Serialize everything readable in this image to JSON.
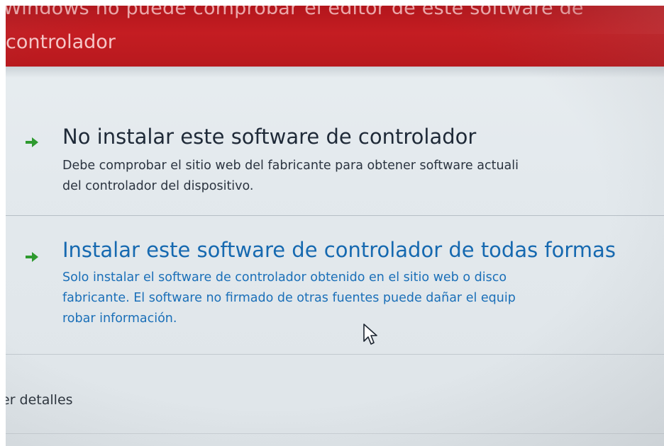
{
  "dialog": {
    "header_line1": "Windows no puede comprobar el editor de este software de",
    "header_line2": "controlador",
    "options": [
      {
        "title": "No instalar este software de controlador",
        "description_lines": [
          "Debe comprobar el sitio web del fabricante para obtener software actuali",
          "del controlador del dispositivo."
        ]
      },
      {
        "title": "Instalar este software de controlador de todas formas",
        "description_lines": [
          "Solo instalar el software de controlador obtenido en el sitio web o disco",
          "fabricante. El software no firmado de otras fuentes puede dañar el equip",
          "robar información."
        ]
      }
    ],
    "details_link": "er detalles"
  },
  "icons": {
    "option_arrow": "green-arrow-icon",
    "cursor": "mouse-pointer-icon"
  },
  "colors": {
    "header_bg": "#c41d22",
    "option1_title": "#1f2a38",
    "option2_title": "#1669b0",
    "arrow_green": "#2e9a2f",
    "content_bg": "#e6ebee"
  }
}
